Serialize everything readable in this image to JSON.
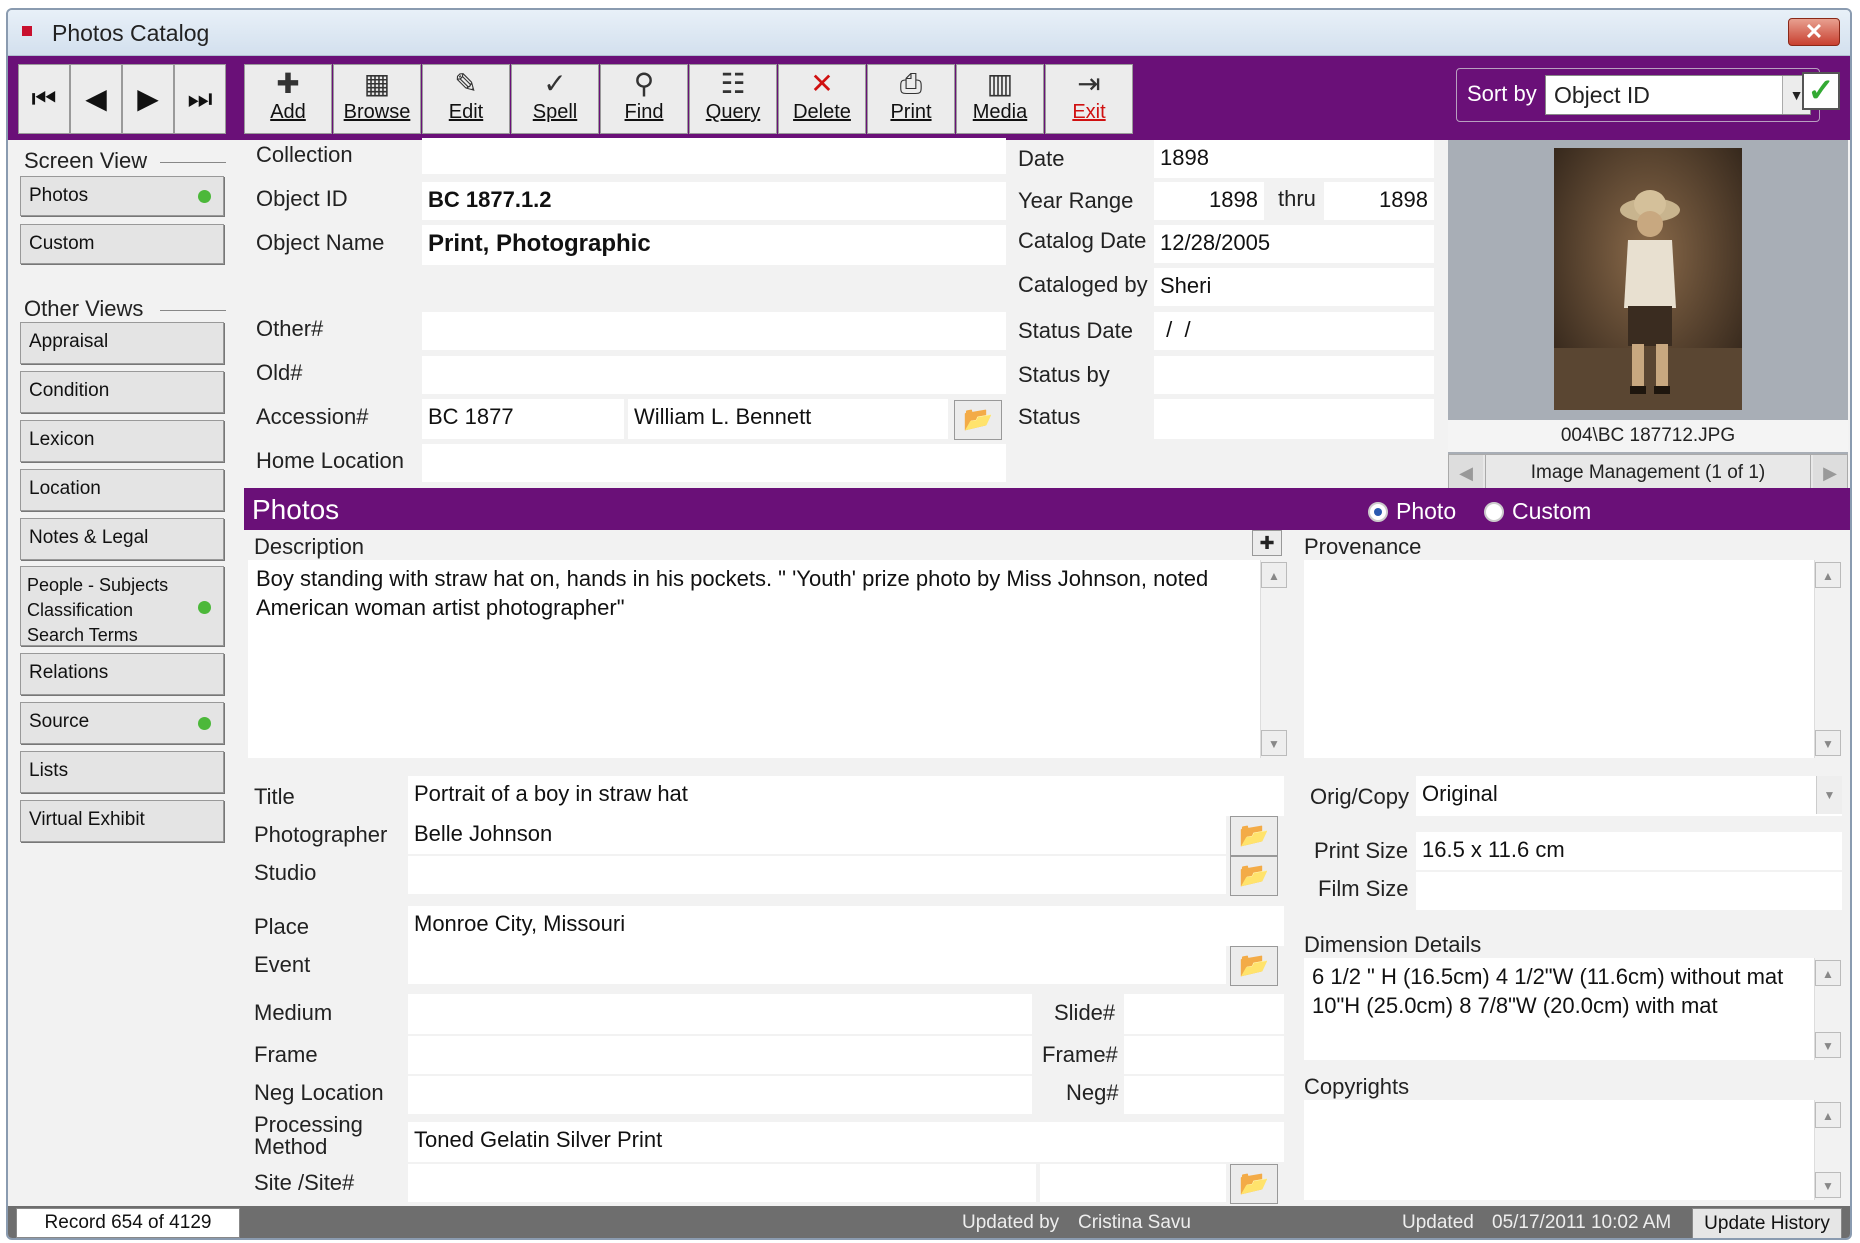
{
  "window": {
    "title": "Photos Catalog",
    "close_glyph": "✕"
  },
  "toolbar": {
    "nav": [
      {
        "glyph": "⏮"
      },
      {
        "glyph": "◀"
      },
      {
        "glyph": "▶"
      },
      {
        "glyph": "⏭"
      }
    ],
    "buttons": [
      {
        "label": "Add",
        "icon": "✚"
      },
      {
        "label": "Browse",
        "icon": "▦"
      },
      {
        "label": "Edit",
        "icon": "✎"
      },
      {
        "label": "Spell",
        "icon": "✓"
      },
      {
        "label": "Find",
        "icon": "⚲"
      },
      {
        "label": "Query",
        "icon": "☷"
      },
      {
        "label": "Delete",
        "icon": "✕"
      },
      {
        "label": "Print",
        "icon": "⎙"
      },
      {
        "label": "Media",
        "icon": "▥"
      },
      {
        "label": "Exit",
        "icon": "⇥"
      }
    ],
    "sort_label": "Sort by",
    "sort_value": "Object ID",
    "dropdown_glyph": "▼",
    "check_glyph": "✓",
    "folder_glyph": "📂"
  },
  "sidebar": {
    "screen_view_heading": "Screen View",
    "screen_views": [
      {
        "label": "Photos",
        "dot": true
      },
      {
        "label": "Custom",
        "dot": false
      }
    ],
    "other_views_heading": "Other Views",
    "other_views": [
      {
        "label": "Appraisal",
        "dot": false
      },
      {
        "label": "Condition",
        "dot": false
      },
      {
        "label": "Lexicon",
        "dot": false
      },
      {
        "label": "Location",
        "dot": false
      },
      {
        "label": "Notes & Legal",
        "dot": false
      },
      {
        "label": "People - Subjects\nClassification\nSearch Terms",
        "dot": true
      },
      {
        "label": "Relations",
        "dot": false
      },
      {
        "label": "Source",
        "dot": true
      },
      {
        "label": "Lists",
        "dot": false
      },
      {
        "label": "Virtual Exhibit",
        "dot": false
      }
    ]
  },
  "record": {
    "collection_label": "Collection",
    "collection": "",
    "object_id_label": "Object ID",
    "object_id": "BC 1877.1.2",
    "object_name_label": "Object Name",
    "object_name": "Print, Photographic",
    "other_label": "Other#",
    "other": "",
    "old_label": "Old#",
    "old": "",
    "accession_label": "Accession#",
    "accession": "BC 1877",
    "accession_name": "William L. Bennett",
    "home_location_label": "Home Location",
    "home_location": "",
    "date_label": "Date",
    "date": "1898",
    "year_range_label": "Year Range",
    "year_from": "1898",
    "thru_label": "thru",
    "year_to": "1898",
    "catalog_date_label": "Catalog Date",
    "catalog_date": "12/28/2005",
    "cataloged_by_label": "Cataloged by",
    "cataloged_by": "Sheri",
    "status_date_label": "Status Date",
    "status_date": " /  /",
    "status_by_label": "Status by",
    "status_by": "",
    "status_label": "Status",
    "status": ""
  },
  "image": {
    "filename": "004\\BC 187712.JPG",
    "management_label": "Image Management (1 of 1)",
    "prev": "◀",
    "next": "▶"
  },
  "section": {
    "title": "Photos",
    "radio_photo": "Photo",
    "radio_custom": "Custom",
    "selected": "Photo"
  },
  "details": {
    "description_label": "Description",
    "description": "Boy standing with straw hat on, hands in his pockets.  \" 'Youth' prize photo by Miss Johnson, noted American woman artist photographer\"",
    "provenance_label": "Provenance",
    "provenance": "",
    "title_label": "Title",
    "title": "Portrait of a boy in straw hat",
    "photographer_label": "Photographer",
    "photographer": "Belle Johnson",
    "studio_label": "Studio",
    "studio": "",
    "place_label": "Place",
    "place": "Monroe City, Missouri",
    "event_label": "Event",
    "event": "",
    "medium_label": "Medium",
    "medium": "",
    "slide_label": "Slide#",
    "slide": "",
    "frame_label": "Frame",
    "frame": "",
    "frame_no_label": "Frame#",
    "frame_no": "",
    "neg_location_label": "Neg Location",
    "neg_location": "",
    "neg_label": "Neg#",
    "neg": "",
    "processing_label": "Processing\nMethod",
    "processing": "Toned Gelatin Silver Print",
    "site_label": "Site /Site#",
    "site": "",
    "site_no": "",
    "orig_copy_label": "Orig/Copy",
    "orig_copy": "Original",
    "print_size_label": "Print Size",
    "print_size": "16.5 x 11.6 cm",
    "film_size_label": "Film Size",
    "film_size": "",
    "dimension_label": "Dimension Details",
    "dimension": "6 1/2 \" H (16.5cm) 4 1/2\"W (11.6cm) without mat\n10\"H (25.0cm) 8 7/8\"W (20.0cm) with mat",
    "copyrights_label": "Copyrights",
    "copyrights": "",
    "plus_glyph": "✚",
    "up": "▲",
    "down": "▼"
  },
  "status_bar": {
    "record_count": "Record 654 of 4129",
    "updated_by_label": "Updated by",
    "updated_by": "Cristina Savu",
    "updated_label": "Updated",
    "updated": "05/17/2011 10:02 AM",
    "history_button": "Update History"
  }
}
